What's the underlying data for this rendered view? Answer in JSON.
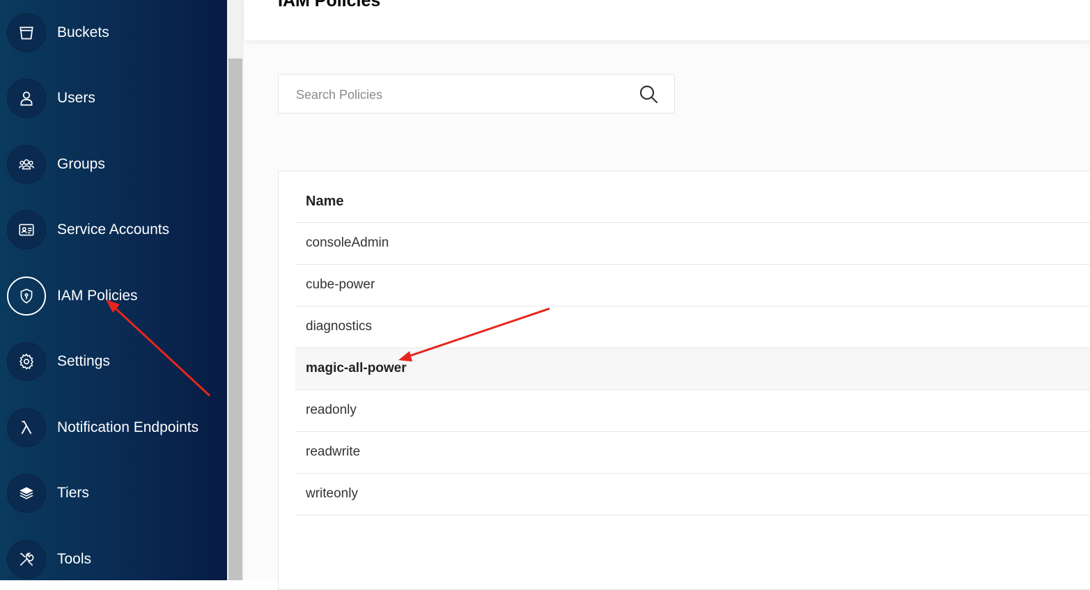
{
  "sidebar": {
    "items": [
      {
        "label": "Buckets",
        "icon": "bucket-icon",
        "active": false
      },
      {
        "label": "Users",
        "icon": "user-icon",
        "active": false
      },
      {
        "label": "Groups",
        "icon": "groups-icon",
        "active": false
      },
      {
        "label": "Service Accounts",
        "icon": "id-card-icon",
        "active": false
      },
      {
        "label": "IAM Policies",
        "icon": "shield-icon",
        "active": true
      },
      {
        "label": "Settings",
        "icon": "gear-icon",
        "active": false
      },
      {
        "label": "Notification Endpoints",
        "icon": "lambda-icon",
        "active": false
      },
      {
        "label": "Tiers",
        "icon": "layers-icon",
        "active": false
      },
      {
        "label": "Tools",
        "icon": "tools-icon",
        "active": false
      }
    ]
  },
  "header": {
    "title": "IAM Policies"
  },
  "search": {
    "placeholder": "Search Policies",
    "value": ""
  },
  "table": {
    "columns": [
      "Name"
    ],
    "rows": [
      "consoleAdmin",
      "cube-power",
      "diagnostics",
      "magic-all-power",
      "readonly",
      "readwrite",
      "writeonly"
    ],
    "highlighted_row": "magic-all-power"
  },
  "colors": {
    "sidebar_bg": "#0a2a52",
    "annotation_arrow": "#e8251d",
    "row_highlight": "#f7f7f7"
  }
}
